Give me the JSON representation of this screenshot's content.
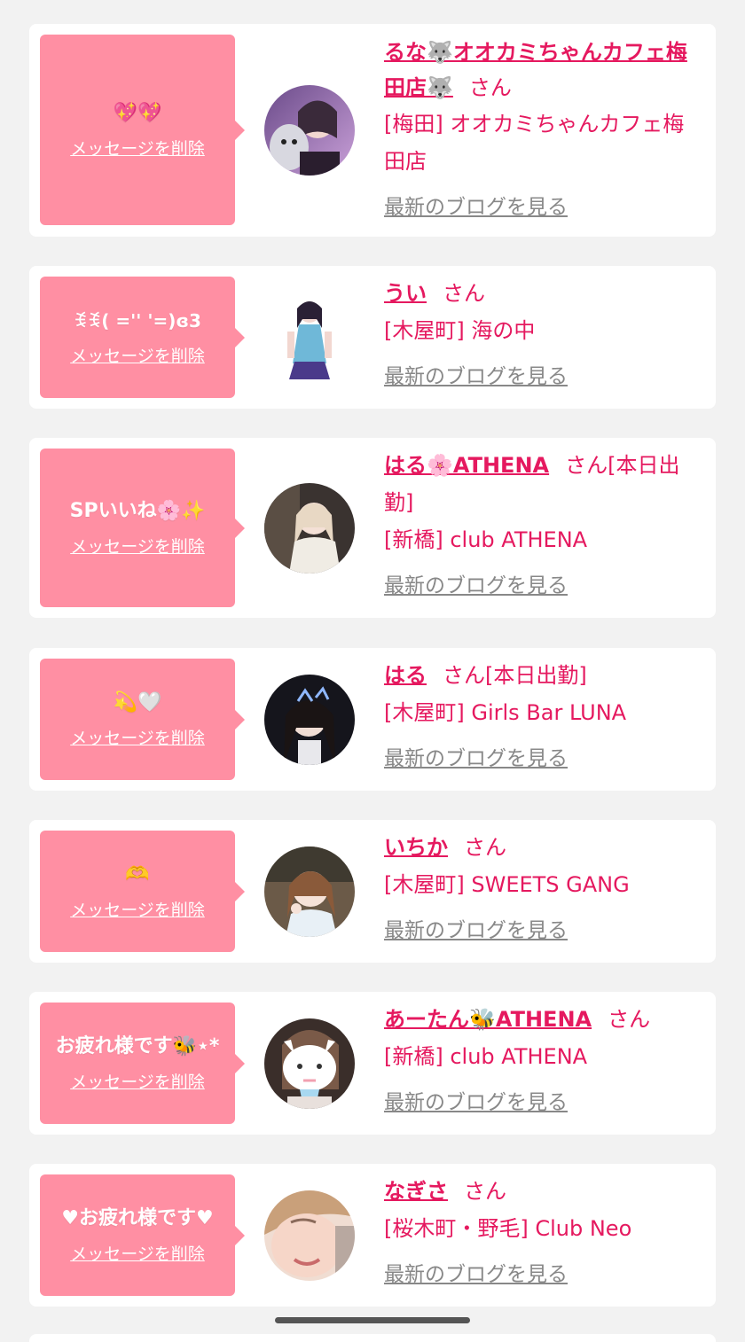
{
  "delete_label": "メッセージを削除",
  "blog_label": "最新のブログを見る",
  "colors": {
    "bubble": "#ff8fa3",
    "accent": "#e5195f",
    "muted": "#888888",
    "background": "#f2f2f2"
  },
  "entries": [
    {
      "message": "💖💖",
      "name": "るな🐺オオカミちゃんカフェ梅田店🐺",
      "suffix": "さん",
      "shop": "[梅田] オオカミちゃんカフェ梅田店"
    },
    {
      "message": "ꉂꉂ( ='' '=)ɞ3",
      "name": "うい",
      "suffix": "さん",
      "shop": "[木屋町] 海の中"
    },
    {
      "message": "SPいいね🌸✨",
      "name": "はる🌸ATHENA",
      "suffix": "さん[本日出勤]",
      "shop": "[新橋] club ATHENA"
    },
    {
      "message": "💫🤍",
      "name": "はる",
      "suffix": "さん[本日出勤]",
      "shop": "[木屋町] Girls Bar LUNA"
    },
    {
      "message": "🫶",
      "name": "いちか",
      "suffix": "さん",
      "shop": "[木屋町] SWEETS GANG"
    },
    {
      "message": "お疲れ様です🐝⋆*",
      "name": "あーたん🐝ATHENA",
      "suffix": "さん",
      "shop": "[新橋] club ATHENA"
    },
    {
      "message": "♥お疲れ様です♥",
      "name": "なぎさ",
      "suffix": "さん",
      "shop": "[桜木町・野毛] Club Neo"
    }
  ]
}
